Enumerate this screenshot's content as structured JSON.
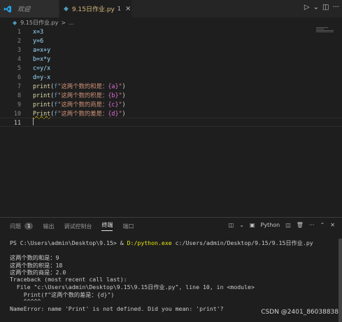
{
  "tabs": [
    {
      "label": "欢迎"
    },
    {
      "label": "9.15日作业.py",
      "badge": "1",
      "close": "×"
    }
  ],
  "breadcrumb": {
    "file": "9.15日作业.py",
    "separator": ">",
    "more": "..."
  },
  "editor": {
    "line_numbers": [
      "1",
      "2",
      "3",
      "4",
      "5",
      "6",
      "7",
      "8",
      "9",
      "10",
      "11"
    ],
    "lines": [
      [
        {
          "t": "x=3",
          "c": "t-var"
        }
      ],
      [
        {
          "t": "y=6",
          "c": "t-var"
        }
      ],
      [
        {
          "t": "a=x+y",
          "c": "t-var"
        }
      ],
      [
        {
          "t": "b=x*y",
          "c": "t-var"
        }
      ],
      [
        {
          "t": "c=y/x",
          "c": "t-var"
        }
      ],
      [
        {
          "t": "d=y-x",
          "c": "t-var"
        }
      ],
      [
        {
          "t": "print",
          "c": "t-fn"
        },
        {
          "t": "(",
          "c": "t-op"
        },
        {
          "t": "f",
          "c": "t-kw"
        },
        {
          "t": "\"这两个数的和是：",
          "c": "t-str"
        },
        {
          "t": "{a}",
          "c": "t-brace"
        },
        {
          "t": "\"",
          "c": "t-str"
        },
        {
          "t": ")",
          "c": "t-op"
        }
      ],
      [
        {
          "t": "print",
          "c": "t-fn"
        },
        {
          "t": "(",
          "c": "t-op"
        },
        {
          "t": "f",
          "c": "t-kw"
        },
        {
          "t": "\"这两个数的积是：",
          "c": "t-str"
        },
        {
          "t": "{b}",
          "c": "t-brace"
        },
        {
          "t": "\"",
          "c": "t-str"
        },
        {
          "t": ")",
          "c": "t-op"
        }
      ],
      [
        {
          "t": "print",
          "c": "t-fn"
        },
        {
          "t": "(",
          "c": "t-op"
        },
        {
          "t": "f",
          "c": "t-kw"
        },
        {
          "t": "\"这两个数的商是：",
          "c": "t-str"
        },
        {
          "t": "{c}",
          "c": "t-brace"
        },
        {
          "t": "\"",
          "c": "t-str"
        },
        {
          "t": ")",
          "c": "t-op"
        }
      ],
      [
        {
          "t": "Print",
          "c": "t-fn squiggle"
        },
        {
          "t": "(",
          "c": "t-op"
        },
        {
          "t": "f",
          "c": "t-kw"
        },
        {
          "t": "\"这两个数的差是：",
          "c": "t-str"
        },
        {
          "t": "{d}",
          "c": "t-brace"
        },
        {
          "t": "\"",
          "c": "t-str"
        },
        {
          "t": ")",
          "c": "t-op"
        }
      ],
      []
    ]
  },
  "panel": {
    "tabs": [
      "问题",
      "输出",
      "调试控制台",
      "终端",
      "端口"
    ],
    "problems_count": "1",
    "shell": "Python",
    "terminal_lines": [
      "PS C:\\Users\\admin\\Desktop\\9.15> & D:/python.exe c:/Users/admin/Desktop/9.15/9.15日作业.py",
      "",
      "这两个数的和是：9",
      "这两个数的积是：18",
      "这两个数的商是：2.0",
      "Traceback (most recent call last):",
      "  File \"c:\\Users\\admin\\Desktop\\9.15\\9.15日作业.py\", line 10, in <module>",
      "    Print(f\"这两个数的差是：{d}\")",
      "    ^^^^^",
      "NameError: name 'Print' is not defined. Did you mean: 'print'?"
    ]
  },
  "watermark": "CSDN @2401_86038838",
  "colors": {
    "accent": "#0078d4",
    "background": "#1e1e1e"
  }
}
